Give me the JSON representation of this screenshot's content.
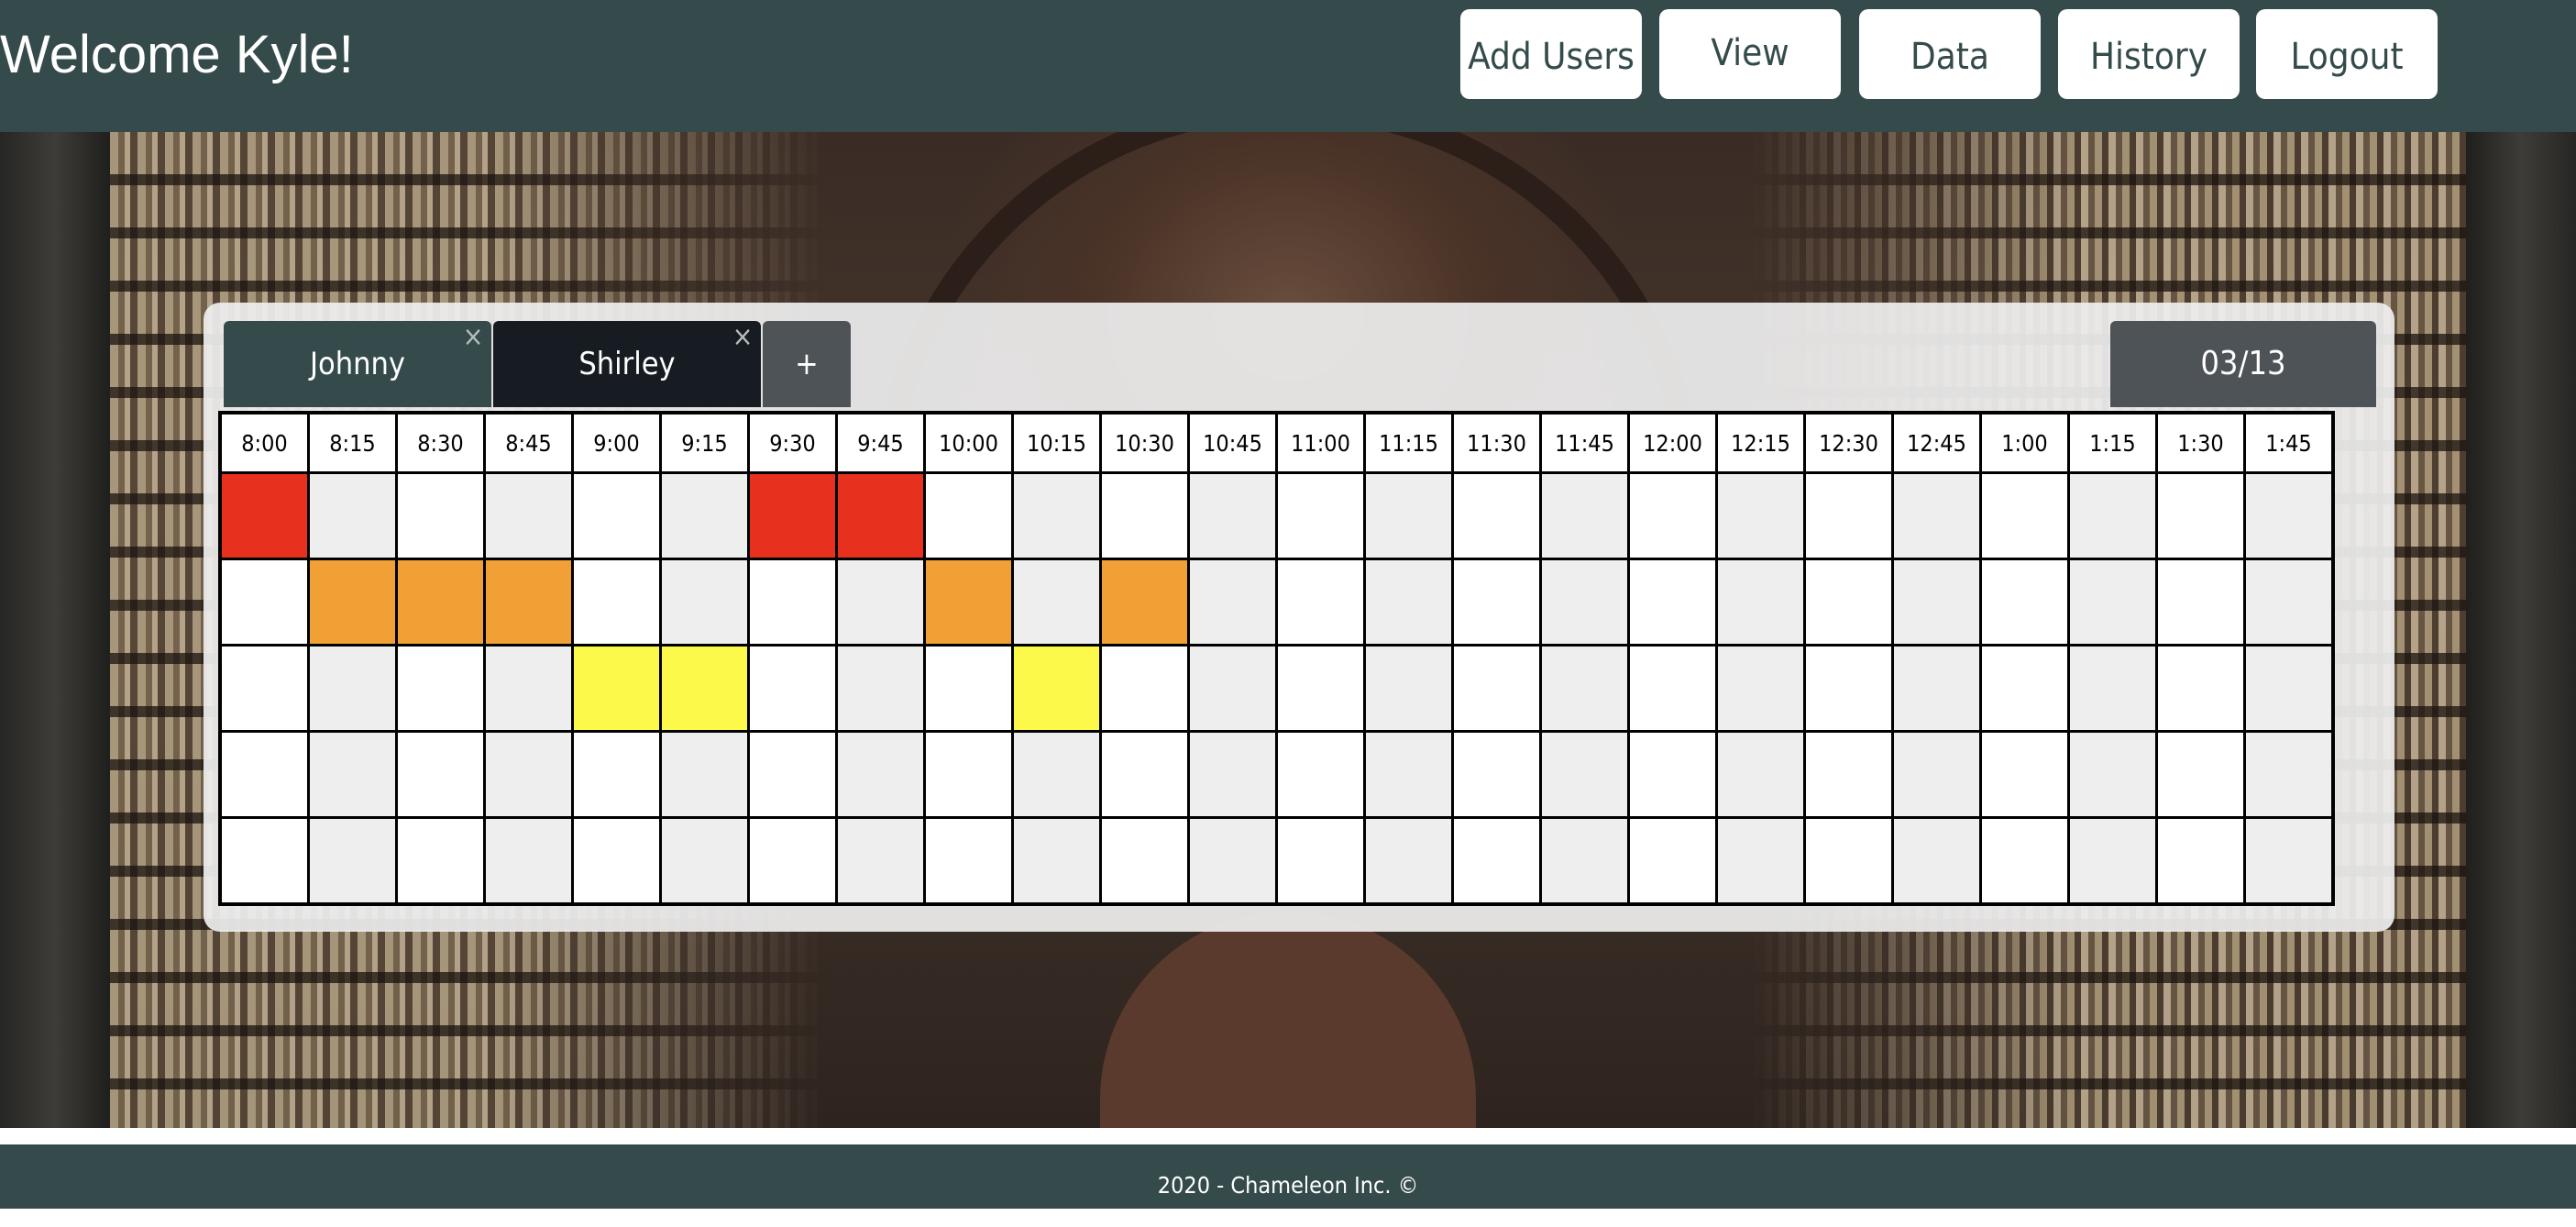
{
  "header": {
    "welcome": "Welcome Kyle!",
    "nav": [
      {
        "label": "Add Users"
      },
      {
        "label": "View"
      },
      {
        "label": "Data"
      },
      {
        "label": "History"
      },
      {
        "label": "Logout"
      }
    ]
  },
  "schedule": {
    "tabs": [
      {
        "label": "Johnny",
        "close": "×"
      },
      {
        "label": "Shirley",
        "close": "×"
      }
    ],
    "add_label": "+",
    "date": "03/13",
    "times": [
      "8:00",
      "8:15",
      "8:30",
      "8:45",
      "9:00",
      "9:15",
      "9:30",
      "9:45",
      "10:00",
      "10:15",
      "10:30",
      "10:45",
      "11:00",
      "11:15",
      "11:30",
      "11:45",
      "12:00",
      "12:15",
      "12:30",
      "12:45",
      "1:00",
      "1:15",
      "1:30",
      "1:45"
    ],
    "colors": {
      "red": "#e8301f",
      "orange": "#f0a034",
      "yellow": "#fdf94b"
    },
    "filled": [
      {
        "row": 0,
        "col": 0,
        "color": "red"
      },
      {
        "row": 0,
        "col": 6,
        "color": "red"
      },
      {
        "row": 0,
        "col": 7,
        "color": "red"
      },
      {
        "row": 1,
        "col": 1,
        "color": "orange"
      },
      {
        "row": 1,
        "col": 2,
        "color": "orange"
      },
      {
        "row": 1,
        "col": 3,
        "color": "orange"
      },
      {
        "row": 1,
        "col": 8,
        "color": "orange"
      },
      {
        "row": 1,
        "col": 10,
        "color": "orange"
      },
      {
        "row": 2,
        "col": 4,
        "color": "yellow"
      },
      {
        "row": 2,
        "col": 5,
        "color": "yellow"
      },
      {
        "row": 2,
        "col": 9,
        "color": "yellow"
      }
    ],
    "row_count": 5
  },
  "footer": {
    "text": "2020 - Chameleon Inc. ©"
  },
  "theme": {
    "header_bg": "#354b4b",
    "shirley_tab": "#171c22"
  }
}
